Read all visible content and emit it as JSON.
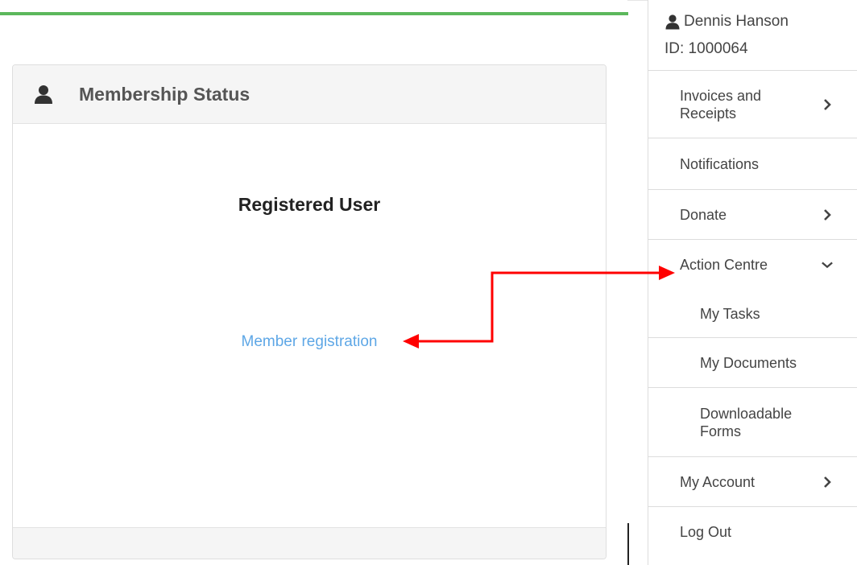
{
  "panel": {
    "title": "Membership Status",
    "status": "Registered User",
    "link": "Member registration",
    "header_icon": "user-icon"
  },
  "sidebar": {
    "user_name": "Dennis Hanson",
    "user_id": "ID: 1000064",
    "items": [
      {
        "label": "Invoices and Receipts",
        "icon": "chevron-right-icon"
      },
      {
        "label": "Notifications"
      },
      {
        "label": "Donate",
        "icon": "chevron-right-icon"
      },
      {
        "label": "Action Centre",
        "icon": "chevron-down-icon"
      },
      {
        "label": "My Tasks"
      },
      {
        "label": "My Documents"
      },
      {
        "label": "Downloadable Forms"
      },
      {
        "label": "My Account",
        "icon": "chevron-right-icon"
      },
      {
        "label": "Log Out"
      }
    ]
  },
  "colors": {
    "accent_green": "#5cb85c",
    "link_blue": "#5ea7e6",
    "annotation_red": "#ff0000"
  }
}
